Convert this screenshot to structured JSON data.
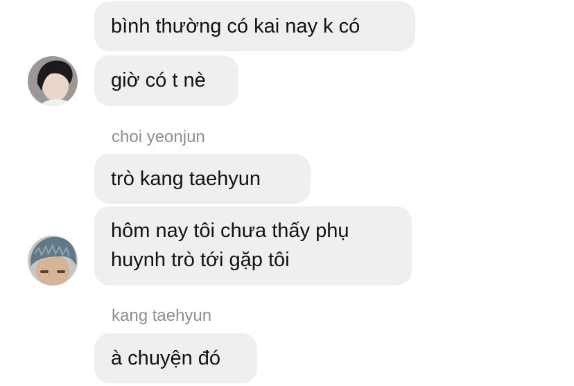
{
  "groups": [
    {
      "sender": null,
      "messages": [
        {
          "text": "bình thường có kai nay k có"
        },
        {
          "text": "giờ có t nè"
        }
      ],
      "avatar": {
        "icon": "user-avatar-dark-hair",
        "hair_color": "#1b1b1e",
        "skin_color": "#ead7cc"
      }
    },
    {
      "sender": "choi yeonjun",
      "messages": [
        {
          "text": "trò kang taehyun"
        },
        {
          "text": "hôm nay tôi chưa thấy phụ huynh trò tới gặp tôi"
        }
      ],
      "avatar": {
        "icon": "user-avatar-blue-hair",
        "hair_color": "#5f7a86",
        "skin_color": "#d6b497"
      }
    },
    {
      "sender": "kang taehyun",
      "messages": [
        {
          "text": "à chuyện đó"
        }
      ]
    }
  ],
  "colors": {
    "bubble_bg": "#efefef",
    "message_text": "#111111",
    "sender_text": "#8e8e8e",
    "background": "#ffffff"
  }
}
